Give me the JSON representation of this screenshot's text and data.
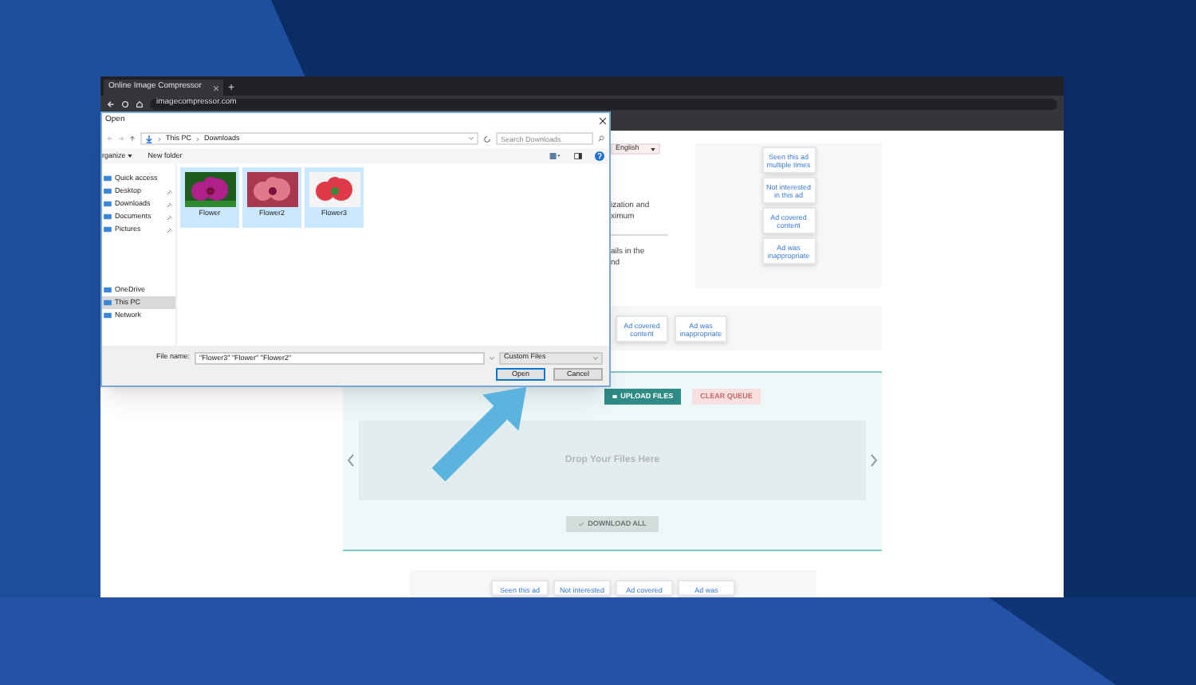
{
  "browser": {
    "tab_title": "Online Image Compressor",
    "new_tab": "+",
    "address": "imagecompressor.com"
  },
  "page": {
    "language": "English",
    "text_blocks": [
      [
        "ization and",
        "ximum"
      ],
      [
        "ails in the",
        "nd"
      ]
    ],
    "ad_panel": {
      "buttons": [
        "Seen this ad multiple times",
        "Not interested in this ad",
        "Ad covered content",
        "Ad was inappropriate"
      ]
    },
    "ad_strip": {
      "buttons": [
        "Ad covered content",
        "Ad was inappropriate"
      ]
    },
    "uploader": {
      "upload": "UPLOAD FILES",
      "clear": "CLEAR QUEUE",
      "drop": "Drop Your Files Here",
      "download": "DOWNLOAD ALL"
    },
    "bottom_ad": {
      "buttons": [
        "Seen this ad",
        "Not interested",
        "Ad covered",
        "Ad was"
      ]
    }
  },
  "dialog": {
    "title": "Open",
    "path": [
      "This PC",
      "Downloads"
    ],
    "search_placeholder": "Search Downloads",
    "toolbar": [
      "rganize",
      "New folder"
    ],
    "sidebar": [
      [
        {
          "label": "Quick access",
          "pinned": false,
          "selected": false
        },
        {
          "label": "Desktop",
          "pinned": true,
          "selected": false
        },
        {
          "label": "Downloads",
          "pinned": true,
          "selected": false
        },
        {
          "label": "Documents",
          "pinned": true,
          "selected": false
        },
        {
          "label": "Pictures",
          "pinned": true,
          "selected": false
        }
      ],
      [
        {
          "label": "OneDrive",
          "pinned": false,
          "selected": false
        },
        {
          "label": "This PC",
          "pinned": false,
          "selected": true
        },
        {
          "label": "Network",
          "pinned": false,
          "selected": false
        }
      ]
    ],
    "files": [
      {
        "name": "Flower",
        "selected": true
      },
      {
        "name": "Flower2",
        "selected": true
      },
      {
        "name": "Flower3",
        "selected": true
      }
    ],
    "file_name_label": "File name:",
    "file_name": "\"Flower3\" \"Flower\" \"Flower2\"",
    "file_type": "Custom Files",
    "buttons": [
      "Open",
      "Cancel"
    ]
  }
}
